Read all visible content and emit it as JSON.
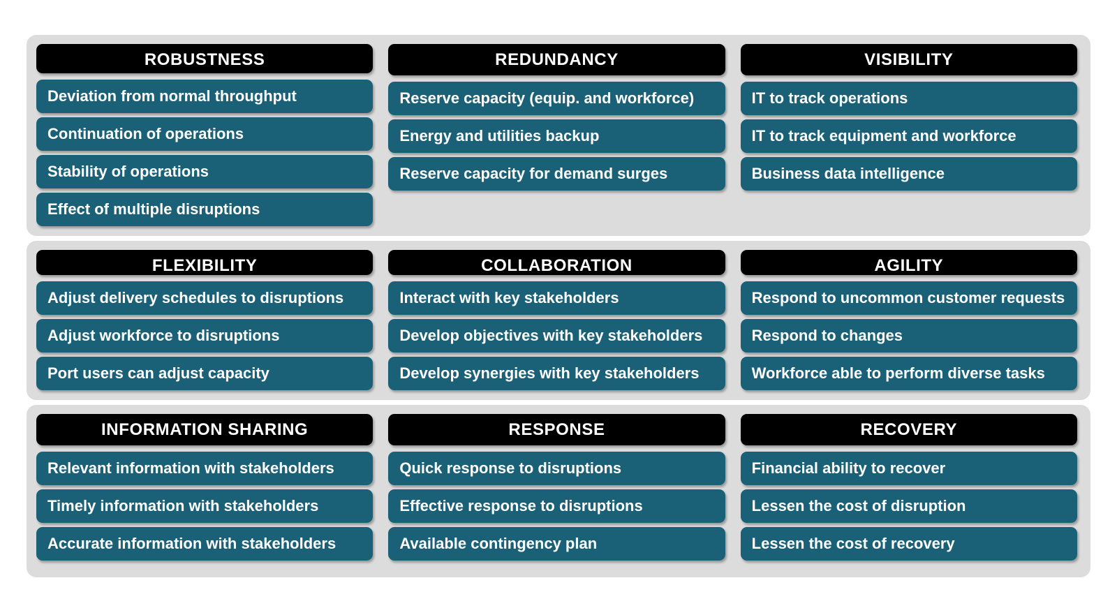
{
  "theme": {
    "page_background": "#ffffff",
    "band_background": "#dcdcdc",
    "header_background": "#000000",
    "header_text_color": "#ffffff",
    "item_background": "#1a6178",
    "item_text_color": "#ffffff"
  },
  "bands": [
    {
      "columns": [
        {
          "title": "ROBUSTNESS",
          "items": [
            "Deviation from normal throughput",
            "Continuation of operations",
            "Stability of operations",
            "Effect of multiple disruptions"
          ]
        },
        {
          "title": "REDUNDANCY",
          "items": [
            "Reserve capacity (equip. and workforce)",
            "Energy and utilities backup",
            "Reserve capacity for demand surges"
          ]
        },
        {
          "title": "VISIBILITY",
          "items": [
            "IT to track operations",
            "IT to track equipment and workforce",
            "Business data intelligence"
          ]
        }
      ]
    },
    {
      "columns": [
        {
          "title": "FLEXIBILITY",
          "items": [
            "Adjust delivery schedules to disruptions",
            "Adjust workforce to disruptions",
            "Port users can adjust capacity"
          ]
        },
        {
          "title": "COLLABORATION",
          "items": [
            "Interact with key stakeholders",
            "Develop objectives with key stakeholders",
            "Develop synergies with key stakeholders"
          ]
        },
        {
          "title": "AGILITY",
          "items": [
            "Respond to uncommon customer requests",
            "Respond to changes",
            "Workforce able to perform diverse tasks"
          ]
        }
      ]
    },
    {
      "columns": [
        {
          "title": "INFORMATION SHARING",
          "items": [
            "Relevant information with stakeholders",
            "Timely information with stakeholders",
            "Accurate information with stakeholders"
          ]
        },
        {
          "title": "RESPONSE",
          "items": [
            "Quick response to disruptions",
            "Effective response to disruptions",
            "Available contingency plan"
          ]
        },
        {
          "title": "RECOVERY",
          "items": [
            "Financial ability to recover",
            "Lessen the cost of disruption",
            "Lessen the cost of recovery"
          ]
        }
      ]
    }
  ]
}
